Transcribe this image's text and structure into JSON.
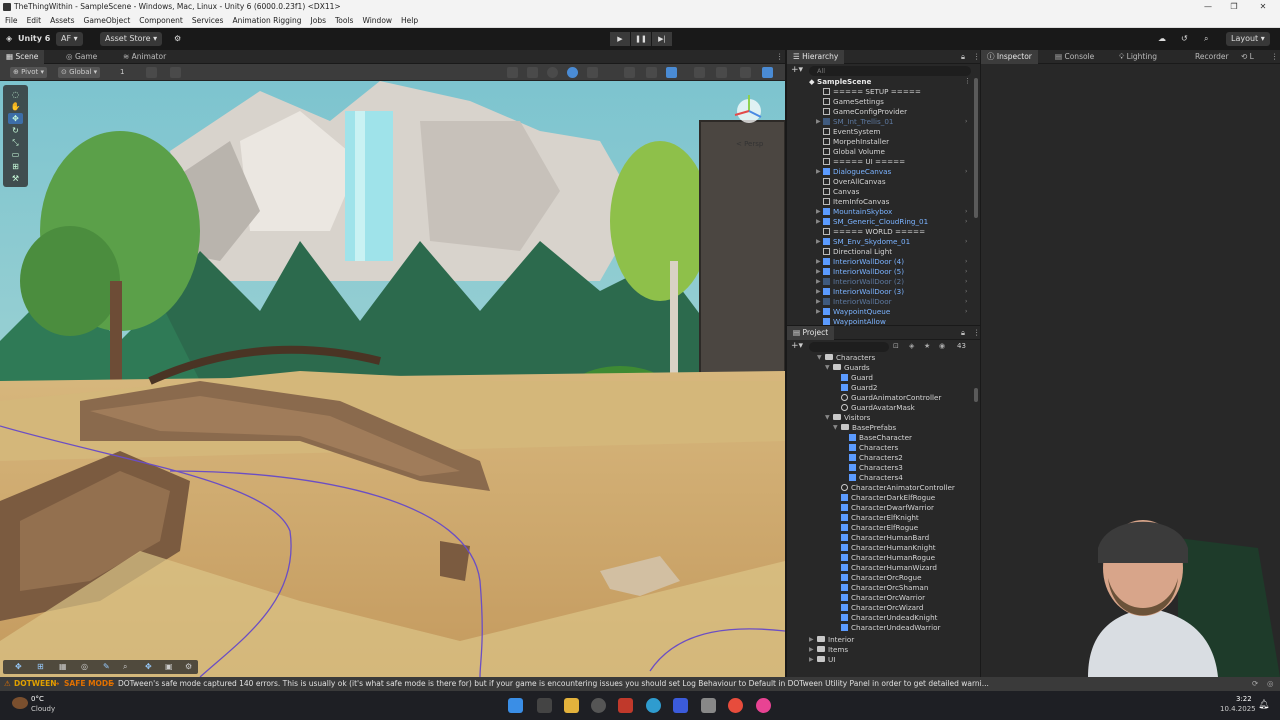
{
  "window": {
    "title": "TheThingWithin - SampleScene - Windows, Mac, Linux - Unity 6 (6000.0.23f1) <DX11>",
    "controls": [
      "—",
      "❐",
      "✕"
    ]
  },
  "menu": [
    "File",
    "Edit",
    "Assets",
    "GameObject",
    "Component",
    "Services",
    "Animation Rigging",
    "Jobs",
    "Tools",
    "Window",
    "Help"
  ],
  "toolbar": {
    "unity_label": "Unity 6",
    "account": "AF",
    "asset_store": "Asset Store",
    "layout": "Layout"
  },
  "scene_tabs": [
    "Scene",
    "Game",
    "Animator"
  ],
  "scene_toolbar": {
    "pivot": "Pivot",
    "global": "Global",
    "grid_value": "1"
  },
  "gizmo_label": "< Persp",
  "hierarchy": {
    "tab": "Hierarchy",
    "search_placeholder": "All",
    "scene": "SampleScene",
    "items": [
      {
        "label": "===== SETUP =====",
        "style": "plain",
        "arrow": false
      },
      {
        "label": "GameSettings",
        "style": "plain",
        "arrow": false
      },
      {
        "label": "GameConfigProvider",
        "style": "plain",
        "arrow": false
      },
      {
        "label": "SM_Int_Trellis_01",
        "style": "dim",
        "arrow": true
      },
      {
        "label": "EventSystem",
        "style": "plain",
        "arrow": false
      },
      {
        "label": "MorpehInstaller",
        "style": "plain",
        "arrow": false
      },
      {
        "label": "Global Volume",
        "style": "plain",
        "arrow": false
      },
      {
        "label": "===== UI =====",
        "style": "plain",
        "arrow": false
      },
      {
        "label": "DialogueCanvas",
        "style": "prefab",
        "arrow": true
      },
      {
        "label": "OverAllCanvas",
        "style": "plain",
        "arrow": false
      },
      {
        "label": "Canvas",
        "style": "plain",
        "arrow": false
      },
      {
        "label": "ItemInfoCanvas",
        "style": "plain",
        "arrow": false
      },
      {
        "label": "MountainSkybox",
        "style": "prefab",
        "arrow": true
      },
      {
        "label": "SM_Generic_CloudRing_01",
        "style": "prefab",
        "arrow": true
      },
      {
        "label": "===== WORLD =====",
        "style": "plain",
        "arrow": false
      },
      {
        "label": "SM_Env_Skydome_01",
        "style": "prefab",
        "arrow": true
      },
      {
        "label": "Directional Light",
        "style": "plain",
        "arrow": false
      },
      {
        "label": "InteriorWallDoor (4)",
        "style": "prefab",
        "arrow": true
      },
      {
        "label": "InteriorWallDoor (5)",
        "style": "prefab",
        "arrow": true
      },
      {
        "label": "InteriorWallDoor (2)",
        "style": "dim",
        "arrow": true
      },
      {
        "label": "InteriorWallDoor (3)",
        "style": "prefab",
        "arrow": true
      },
      {
        "label": "InteriorWallDoor",
        "style": "dim",
        "arrow": true
      },
      {
        "label": "WaypointQueue",
        "style": "prefab",
        "arrow": true
      },
      {
        "label": "WaypointAllow",
        "style": "prefab",
        "arrow": false
      }
    ]
  },
  "project": {
    "tab": "Project",
    "badge": "43",
    "items": [
      {
        "label": "Characters",
        "kind": "folder",
        "indent": 1
      },
      {
        "label": "Guards",
        "kind": "folder",
        "indent": 2
      },
      {
        "label": "Guard",
        "kind": "prefab",
        "indent": 3
      },
      {
        "label": "Guard2",
        "kind": "prefab",
        "indent": 3
      },
      {
        "label": "GuardAnimatorController",
        "kind": "anim",
        "indent": 3
      },
      {
        "label": "GuardAvatarMask",
        "kind": "anim",
        "indent": 3
      },
      {
        "label": "Visitors",
        "kind": "folder",
        "indent": 2
      },
      {
        "label": "BasePrefabs",
        "kind": "folder",
        "indent": 3
      },
      {
        "label": "BaseCharacter",
        "kind": "prefab",
        "indent": 4
      },
      {
        "label": "Characters",
        "kind": "prefab",
        "indent": 4
      },
      {
        "label": "Characters2",
        "kind": "prefab",
        "indent": 4
      },
      {
        "label": "Characters3",
        "kind": "prefab",
        "indent": 4
      },
      {
        "label": "Characters4",
        "kind": "prefab",
        "indent": 4
      },
      {
        "label": "CharacterAnimatorController",
        "kind": "anim",
        "indent": 3
      },
      {
        "label": "CharacterDarkElfRogue",
        "kind": "prefab",
        "indent": 3
      },
      {
        "label": "CharacterDwarfWarrior",
        "kind": "prefab",
        "indent": 3
      },
      {
        "label": "CharacterElfKnight",
        "kind": "prefab",
        "indent": 3
      },
      {
        "label": "CharacterElfRogue",
        "kind": "prefab",
        "indent": 3
      },
      {
        "label": "CharacterHumanBard",
        "kind": "prefab",
        "indent": 3
      },
      {
        "label": "CharacterHumanKnight",
        "kind": "prefab",
        "indent": 3
      },
      {
        "label": "CharacterHumanRogue",
        "kind": "prefab",
        "indent": 3
      },
      {
        "label": "CharacterHumanWizard",
        "kind": "prefab",
        "indent": 3
      },
      {
        "label": "CharacterOrcRogue",
        "kind": "prefab",
        "indent": 3
      },
      {
        "label": "CharacterOrcShaman",
        "kind": "prefab",
        "indent": 3
      },
      {
        "label": "CharacterOrcWarrior",
        "kind": "prefab",
        "indent": 3
      },
      {
        "label": "CharacterOrcWizard",
        "kind": "prefab",
        "indent": 3
      },
      {
        "label": "CharacterUndeadKnight",
        "kind": "prefab",
        "indent": 3
      },
      {
        "label": "CharacterUndeadWarrior",
        "kind": "prefab",
        "indent": 3
      },
      {
        "label": "Interior",
        "kind": "folder",
        "indent": 0
      },
      {
        "label": "Items",
        "kind": "folder",
        "indent": 0
      },
      {
        "label": "UI",
        "kind": "folder",
        "indent": 0
      }
    ]
  },
  "right_tabs": [
    "Inspector",
    "Console",
    "Lighting",
    "Recorder"
  ],
  "status": {
    "tag": "DOTWEEN",
    "mode": "SAFE MODE",
    "message": "DOTween's safe mode captured 140 errors. This is usually ok (it's what safe mode is there for) but if your game is encountering issues you should set Log Behaviour to Default in DOTween Utility Panel in order to get detailed warni..."
  },
  "taskbar": {
    "temp": "0°C",
    "weather": "Cloudy",
    "time": "3:22",
    "date": "10.4.2025"
  },
  "colors": {
    "accent": "#2c5d87",
    "prefab_blue": "#7bb3ff",
    "status_orange": "#e07000"
  }
}
